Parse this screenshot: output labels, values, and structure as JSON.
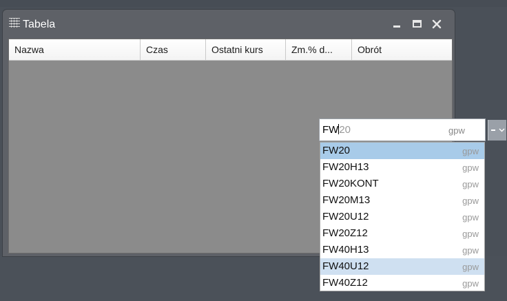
{
  "window": {
    "title": "Tabela",
    "icon": "grid-table-icon"
  },
  "table": {
    "columns": [
      "Nazwa",
      "Czas",
      "Ostatni kurs",
      "Zm.% d...",
      "Obrót"
    ]
  },
  "symbol_search": {
    "typed": "FW",
    "autocomplete_rest": "20",
    "market": "gpw"
  },
  "suggestions": [
    {
      "symbol": "FW20",
      "market": "gpw",
      "state": "selected"
    },
    {
      "symbol": "FW20H13",
      "market": "gpw",
      "state": ""
    },
    {
      "symbol": "FW20KONT",
      "market": "gpw",
      "state": ""
    },
    {
      "symbol": "FW20M13",
      "market": "gpw",
      "state": ""
    },
    {
      "symbol": "FW20U12",
      "market": "gpw",
      "state": ""
    },
    {
      "symbol": "FW20Z12",
      "market": "gpw",
      "state": ""
    },
    {
      "symbol": "FW40H13",
      "market": "gpw",
      "state": ""
    },
    {
      "symbol": "FW40U12",
      "market": "gpw",
      "state": "hover"
    },
    {
      "symbol": "FW40Z12",
      "market": "gpw",
      "state": ""
    }
  ]
}
